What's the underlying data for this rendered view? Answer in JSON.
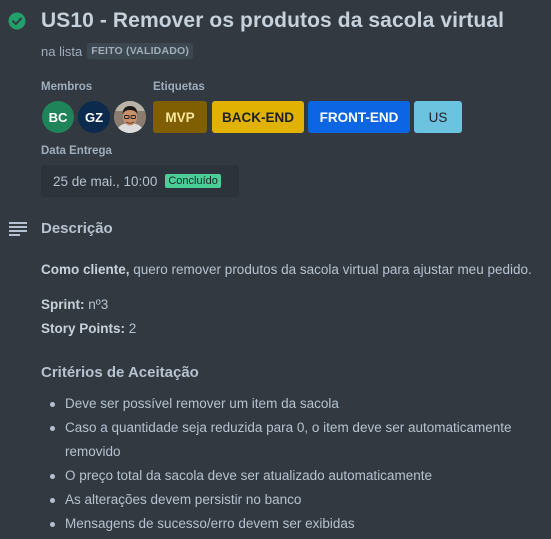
{
  "card": {
    "title": "US10 - Remover os produtos da sacola virtual",
    "list_prefix": "na lista",
    "list_name": "FEITO (VALIDADO)"
  },
  "members": {
    "label": "Membros",
    "items": [
      {
        "initials": "BC",
        "color": "#1f845a"
      },
      {
        "initials": "GZ",
        "color": "#0c2a4d"
      },
      {
        "initials": "",
        "type": "photo"
      }
    ]
  },
  "labels": {
    "label": "Etiquetas",
    "items": [
      {
        "text": "MVP",
        "color": "#7f5f01"
      },
      {
        "text": "BACK-END",
        "color": "#e2b203"
      },
      {
        "text": "FRONT-END",
        "color": "#0c66e4"
      },
      {
        "text": "US",
        "color": "#6cc3e0"
      }
    ]
  },
  "due": {
    "label": "Data Entrega",
    "date": "25 de mai., 10:00",
    "status": "Concluído",
    "status_color": "#4bce97"
  },
  "description": {
    "heading": "Descrição",
    "intro_bold": "Como cliente,",
    "intro_text": " quero remover produtos da sacola virtual para ajustar meu pedido.",
    "sprint_label": "Sprint:",
    "sprint_value": " nº3",
    "points_label": "Story Points:",
    "points_value": " 2"
  },
  "criteria": {
    "heading": "Critérios de Aceitação",
    "items": [
      "Deve ser possível remover um item da sacola",
      "Caso a quantidade seja reduzida para 0, o item deve ser automaticamente removido",
      "O preço total da sacola deve ser atualizado automaticamente",
      "As alterações devem persistir no banco",
      "Mensagens de sucesso/erro devem ser exibidas"
    ]
  },
  "icons": {
    "complete": "check-circle-icon",
    "description": "text-lines-icon"
  },
  "colors": {
    "background": "#323940",
    "complete": "#22a06b"
  }
}
